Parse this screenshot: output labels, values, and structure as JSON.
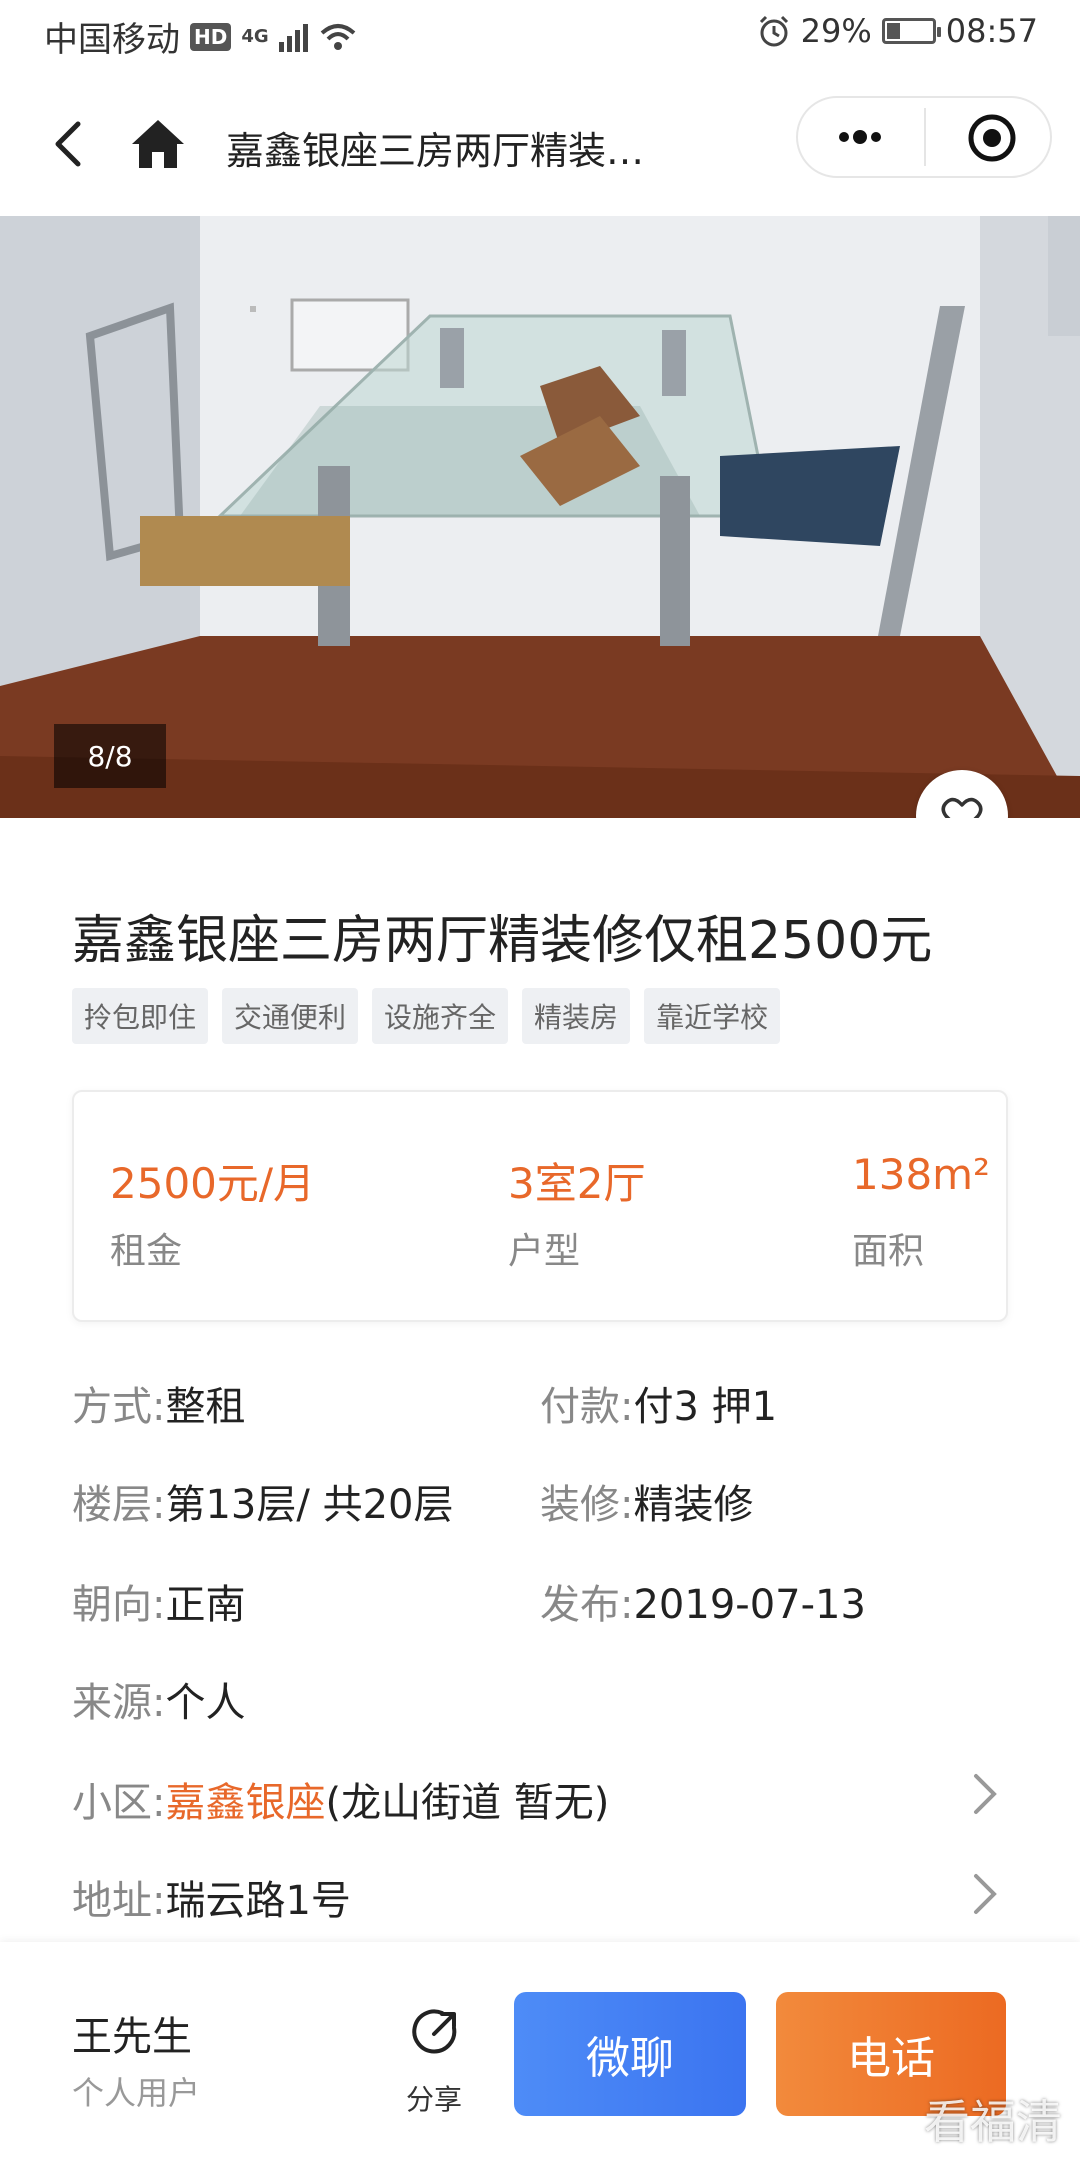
{
  "status_bar": {
    "carrier": "中国移动",
    "hd": "HD",
    "network": "4G",
    "battery": "29%",
    "battery_level": 0.29,
    "time": "08:57"
  },
  "nav": {
    "title": "嘉鑫银座三房两厅精装…"
  },
  "gallery": {
    "counter": "8/8"
  },
  "listing": {
    "title": "嘉鑫银座三房两厅精装修仅租2500元",
    "tags": [
      "拎包即住",
      "交通便利",
      "设施齐全",
      "精装房",
      "靠近学校"
    ]
  },
  "stats": {
    "rent": {
      "value": "2500元/月",
      "label": "租金"
    },
    "layout": {
      "value": "3室2厅",
      "label": "户型"
    },
    "area": {
      "value": "138m²",
      "label": "面积"
    }
  },
  "details": {
    "mode_key": "方式:",
    "mode_val": "整租",
    "pay_key": "付款:",
    "pay_val": "付3  押1",
    "floor_key": "楼层:",
    "floor_val": "第13层/  共20层",
    "deco_key": "装修:",
    "deco_val": "精装修",
    "orient_key": "朝向:",
    "orient_val": "正南",
    "publish_key": "发布:",
    "publish_val": "2019-07-13",
    "source_key": "来源:",
    "source_val": "个人",
    "community_key": "小区:",
    "community_name": "嘉鑫银座",
    "community_extra": "(龙山街道  暂无)",
    "address_key": "地址:",
    "address_val": "瑞云路1号"
  },
  "bottom_bar": {
    "owner_name": "王先生",
    "owner_type": "个人用户",
    "share_label": "分享",
    "chat_label": "微聊",
    "call_label": "电话"
  },
  "watermark": "看福清",
  "colors": {
    "accent_orange": "#e8682a",
    "chat_blue": "#3b74f0",
    "call_orange": "#ec6a22"
  }
}
